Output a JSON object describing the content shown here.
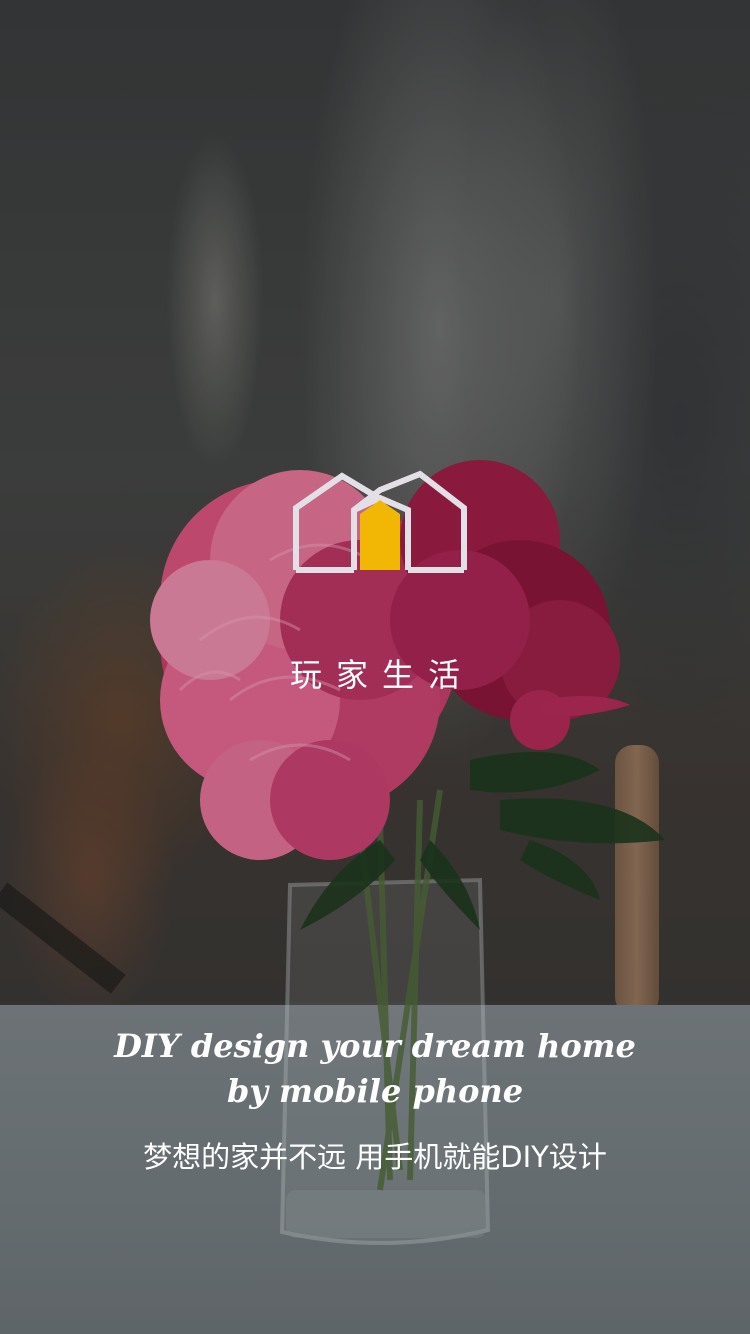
{
  "splash": {
    "brand_name": "玩家生活",
    "tagline_en": "DIY design your dream home by mobile phone",
    "tagline_cn": "梦想的家并不远 用手机就能DIY设计"
  },
  "logo": {
    "icon": "twin-house-icon",
    "outline_color": "#e3dfe6",
    "door_color": "#f2b705"
  },
  "background": {
    "image": "blurred-room-photo-with-pink-peony-bouquet-in-glass-vase"
  }
}
